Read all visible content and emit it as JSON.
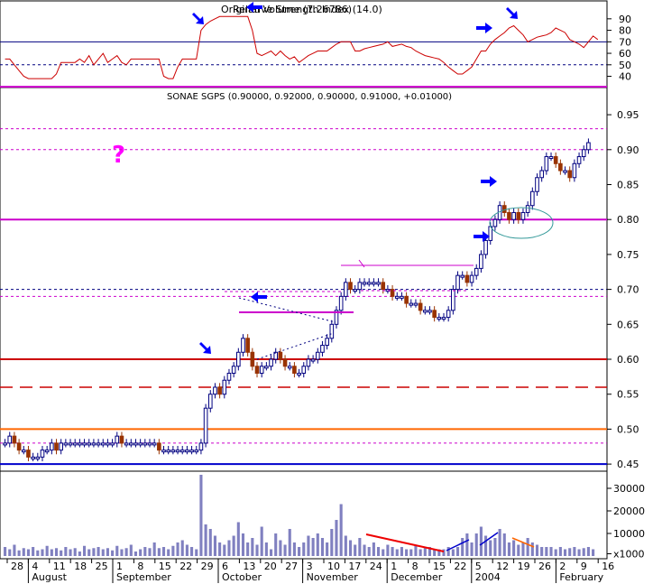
{
  "rsi_panel": {
    "label": "Original Volume (7.26786)",
    "overlay_label": "Relative Strength Index (14.0)",
    "y_ticks": [
      40,
      50,
      60,
      70,
      80,
      90
    ],
    "ylim": [
      31,
      104
    ],
    "levels": [
      {
        "value": 70,
        "style": "solid",
        "color": "#000080"
      },
      {
        "value": 50,
        "style": "dashed",
        "color": "#000080"
      }
    ],
    "color": "#cc0000"
  },
  "price_panel": {
    "title": "SONAE SGPS (0.90000, 0.92000, 0.90000, 0.91000, +0.01000)",
    "y_ticks": [
      "0.45",
      "0.50",
      "0.55",
      "0.60",
      "0.65",
      "0.70",
      "0.75",
      "0.80",
      "0.85",
      "0.90",
      "0.95"
    ],
    "ylim": [
      0.445,
      0.985
    ],
    "annotation_question": "?",
    "horizontal_lines": [
      {
        "value": 0.99,
        "color": "#cc00cc",
        "style": "solid"
      },
      {
        "value": 0.93,
        "color": "#cc00cc",
        "style": "dashed"
      },
      {
        "value": 0.9,
        "color": "#cc00cc",
        "style": "dashed"
      },
      {
        "value": 0.8,
        "color": "#cc00cc",
        "style": "solid"
      },
      {
        "value": 0.7,
        "color": "#000080",
        "style": "dashed"
      },
      {
        "value": 0.69,
        "color": "#cc00cc",
        "style": "dashed"
      },
      {
        "value": 0.6,
        "color": "#cc0000",
        "style": "solid"
      },
      {
        "value": 0.56,
        "color": "#cc0000",
        "style": "longdash"
      },
      {
        "value": 0.5,
        "color": "#ff6600",
        "style": "solid"
      },
      {
        "value": 0.48,
        "color": "#cc00cc",
        "style": "dashed"
      },
      {
        "value": 0.45,
        "color": "#0000cc",
        "style": "solid"
      }
    ]
  },
  "volume_panel": {
    "y_ticks": [
      {
        "value": 30000,
        "label": "30000"
      },
      {
        "value": 20000,
        "label": "20000"
      },
      {
        "value": 10000,
        "label": "10000"
      },
      {
        "value": 1000,
        "label": "x1000"
      }
    ],
    "ylim": [
      0,
      36000
    ]
  },
  "x_axis": {
    "day_ticks": [
      "28",
      "4",
      "11",
      "18",
      "25",
      "1",
      "8",
      "15",
      "22",
      "29",
      "6",
      "13",
      "20",
      "27",
      "3",
      "10",
      "17",
      "24",
      "1",
      "8",
      "15",
      "22",
      "5",
      "12",
      "19",
      "26",
      "2",
      "9",
      "16"
    ],
    "month_labels": [
      "August",
      "September",
      "October",
      "November",
      "December",
      "2004",
      "February"
    ]
  },
  "colors": {
    "up_bar": "#000080",
    "down_bar": "#993300",
    "magenta": "#cc00cc",
    "blue_arrow": "#0000ff",
    "volume": "#8080c0",
    "grid": "#808080"
  },
  "chart_data": {
    "type": "candlestick",
    "title": "SONAE SGPS",
    "last_quote": {
      "open": 0.9,
      "high": 0.92,
      "low": 0.9,
      "close": 0.91,
      "change": 0.01
    },
    "period": {
      "start": "2003-07-28",
      "end": "2004-02-13"
    },
    "ohlc_closes": [
      0.48,
      0.49,
      0.48,
      0.47,
      0.47,
      0.46,
      0.46,
      0.46,
      0.47,
      0.47,
      0.48,
      0.47,
      0.48,
      0.48,
      0.48,
      0.48,
      0.48,
      0.48,
      0.48,
      0.48,
      0.48,
      0.48,
      0.48,
      0.48,
      0.49,
      0.48,
      0.48,
      0.48,
      0.48,
      0.48,
      0.48,
      0.48,
      0.48,
      0.47,
      0.47,
      0.47,
      0.47,
      0.47,
      0.47,
      0.47,
      0.47,
      0.47,
      0.48,
      0.53,
      0.55,
      0.56,
      0.55,
      0.57,
      0.58,
      0.59,
      0.61,
      0.63,
      0.61,
      0.59,
      0.58,
      0.59,
      0.59,
      0.6,
      0.61,
      0.6,
      0.59,
      0.59,
      0.58,
      0.58,
      0.59,
      0.6,
      0.6,
      0.61,
      0.62,
      0.63,
      0.65,
      0.67,
      0.69,
      0.71,
      0.7,
      0.7,
      0.71,
      0.71,
      0.71,
      0.71,
      0.71,
      0.7,
      0.7,
      0.69,
      0.69,
      0.69,
      0.68,
      0.68,
      0.68,
      0.67,
      0.67,
      0.67,
      0.66,
      0.66,
      0.66,
      0.67,
      0.7,
      0.72,
      0.72,
      0.71,
      0.72,
      0.73,
      0.75,
      0.77,
      0.79,
      0.8,
      0.82,
      0.81,
      0.8,
      0.81,
      0.8,
      0.81,
      0.82,
      0.84,
      0.86,
      0.87,
      0.89,
      0.89,
      0.88,
      0.87,
      0.87,
      0.86,
      0.88,
      0.89,
      0.9,
      0.91
    ],
    "volume_values": [
      4000,
      3000,
      5000,
      2500,
      3500,
      3000,
      4000,
      2500,
      3000,
      4500,
      3000,
      3500,
      2500,
      4000,
      3000,
      3500,
      2000,
      4500,
      3000,
      3500,
      4000,
      3000,
      3500,
      2500,
      4500,
      3000,
      3500,
      5000,
      2000,
      3000,
      4000,
      3500,
      6000,
      3500,
      4000,
      3000,
      4500,
      6000,
      7000,
      5000,
      4000,
      3000,
      36000,
      14000,
      12000,
      9000,
      6000,
      5000,
      7000,
      9000,
      15000,
      10000,
      6000,
      8000,
      5000,
      13000,
      6000,
      3000,
      10000,
      7000,
      5000,
      12000,
      6000,
      4000,
      6000,
      9000,
      8000,
      10000,
      8000,
      6000,
      12000,
      16000,
      23000,
      9000,
      7000,
      5000,
      8000,
      5000,
      4000,
      6000,
      4000,
      3000,
      5000,
      4000,
      3000,
      4000,
      3000,
      3000,
      5000,
      3000,
      4000,
      4000,
      3000,
      3000,
      3000,
      4000,
      3000,
      4000,
      8000,
      10000,
      6000,
      10000,
      13000,
      9000,
      7000,
      8000,
      12000,
      10000,
      6000,
      7000,
      5000,
      6000,
      8000,
      6000,
      5000,
      4000,
      4000,
      4000,
      3000,
      4000,
      3000,
      3500,
      4000,
      3000,
      3500,
      4000,
      3000
    ],
    "rsi_values": [
      55,
      55,
      50,
      45,
      40,
      38,
      38,
      38,
      38,
      38,
      38,
      42,
      52,
      52,
      52,
      52,
      55,
      52,
      58,
      50,
      55,
      60,
      52,
      55,
      58,
      52,
      50,
      55,
      55,
      55,
      55,
      55,
      55,
      55,
      40,
      38,
      38,
      48,
      55,
      55,
      55,
      55,
      80,
      85,
      88,
      90,
      92,
      92,
      92,
      92,
      92,
      92,
      92,
      80,
      60,
      58,
      60,
      62,
      58,
      62,
      58,
      55,
      57,
      52,
      55,
      58,
      60,
      62,
      62,
      62,
      65,
      68,
      70,
      70,
      70,
      62,
      62,
      64,
      65,
      66,
      67,
      68,
      70,
      66,
      67,
      68,
      66,
      65,
      62,
      60,
      58,
      57,
      56,
      55,
      52,
      48,
      45,
      42,
      42,
      45,
      48,
      55,
      62,
      62,
      68,
      72,
      75,
      78,
      82,
      84,
      80,
      76,
      70,
      72,
      74,
      75,
      76,
      78,
      82,
      80,
      78,
      72,
      70,
      68,
      65,
      70,
      75,
      72
    ],
    "xlabel": "",
    "ylabel": "",
    "annotations": [
      "blue arrows at breakouts",
      "green ellipse consolidation near 0.80 (Jan 2004)"
    ]
  }
}
